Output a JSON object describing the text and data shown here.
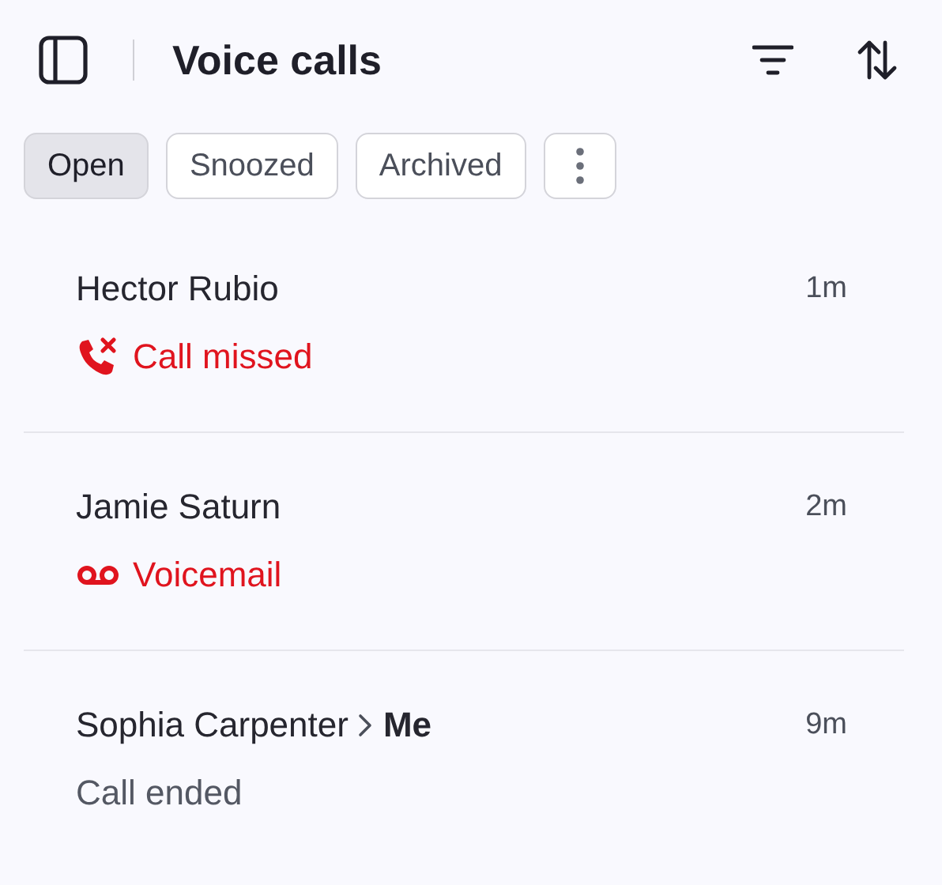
{
  "header": {
    "title": "Voice calls"
  },
  "tabs": [
    {
      "label": "Open",
      "selected": true
    },
    {
      "label": "Snoozed",
      "selected": false
    },
    {
      "label": "Archived",
      "selected": false
    }
  ],
  "calls": [
    {
      "caller": "Hector Rubio",
      "time": "1m",
      "kind": "missed",
      "status": "Call missed"
    },
    {
      "caller": "Jamie Saturn",
      "time": "2m",
      "kind": "voicemail",
      "status": "Voicemail"
    },
    {
      "caller": "Sophia Carpenter",
      "callee": "Me",
      "time": "9m",
      "kind": "ended",
      "status": "Call ended"
    }
  ]
}
